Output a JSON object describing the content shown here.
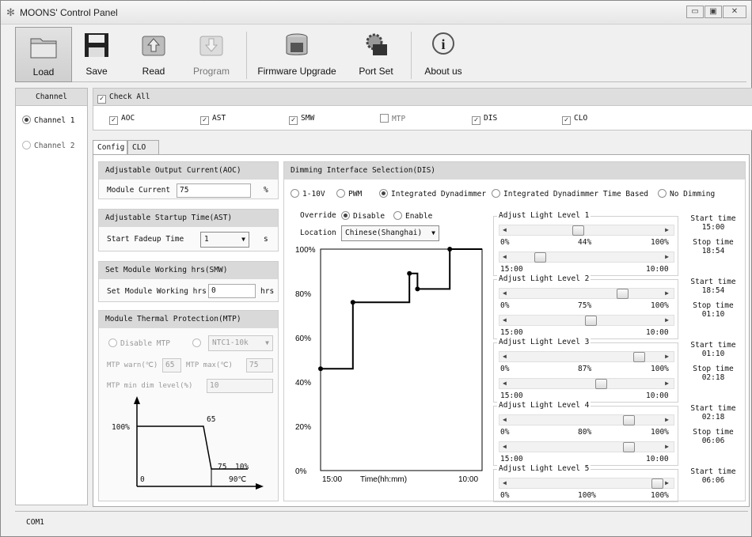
{
  "window": {
    "title": "MOONS' Control Panel"
  },
  "toolbar": {
    "load": "Load",
    "save": "Save",
    "read": "Read",
    "program": "Program",
    "firmware": "Firmware Upgrade",
    "portset": "Port Set",
    "about": "About us"
  },
  "channel": {
    "header": "Channel",
    "ch1": "Channel 1",
    "ch2": "Channel 2"
  },
  "checks": {
    "all": "Check All",
    "aoc": "AOC",
    "ast": "AST",
    "smw": "SMW",
    "mtp": "MTP",
    "dis": "DIS",
    "clo": "CLO"
  },
  "tabs": {
    "config": "Config",
    "clo": "CLO"
  },
  "aoc": {
    "title": "Adjustable Output Current(AOC)",
    "label": "Module Current",
    "value": "75",
    "unit": "%"
  },
  "ast": {
    "title": "Adjustable Startup Time(AST)",
    "label": "Start Fadeup Time",
    "value": "1",
    "unit": "s"
  },
  "smw": {
    "title": "Set Module Working hrs(SMW)",
    "label": "Set Module Working hrs",
    "value": "0",
    "unit": "hrs"
  },
  "mtp": {
    "title": "Module Thermal Protection(MTP)",
    "disable": "Disable MTP",
    "ntc": "NTC1-10k",
    "warn_label": "MTP warn(℃)",
    "warn_value": "65",
    "max_label": "MTP max(℃)",
    "max_value": "75",
    "min_label": "MTP min dim level(%)",
    "min_value": "10",
    "graph": {
      "y100": "100%",
      "p65": "65",
      "p75": "75",
      "p10": "10%",
      "x0": "0",
      "x90": "90℃"
    }
  },
  "dis": {
    "title": "Dimming Interface Selection(DIS)",
    "opt1": "1-10V",
    "opt2": "PWM",
    "opt3": "Integrated Dynadimmer",
    "opt4": "Integrated Dynadimmer Time Based",
    "opt5": "No Dimming",
    "override_label": "Override",
    "disable": "Disable",
    "enable": "Enable",
    "location_label": "Location",
    "location_value": "Chinese(Shanghai)"
  },
  "chart_data": {
    "type": "line",
    "xlabel": "Time(hh:mm)",
    "x_start": "15:00",
    "x_end": "10:00",
    "y_ticks": [
      "0%",
      "20%",
      "40%",
      "60%",
      "80%",
      "100%"
    ],
    "points": [
      [
        0,
        46
      ],
      [
        0.2,
        46
      ],
      [
        0.2,
        76
      ],
      [
        0.55,
        76
      ],
      [
        0.55,
        89
      ],
      [
        0.6,
        89
      ],
      [
        0.6,
        82
      ],
      [
        0.8,
        82
      ],
      [
        0.8,
        100
      ],
      [
        1,
        100
      ]
    ]
  },
  "levels": [
    {
      "title": "Adjust Light Level 1",
      "min": "0%",
      "val": "44%",
      "max": "100%",
      "level": 0.44,
      "t1": "15:00",
      "t2": "10:00",
      "time": 0.17,
      "start_label": "Start time",
      "start": "15:00",
      "stop_label": "Stop time",
      "stop": "18:54"
    },
    {
      "title": "Adjust Light Level 2",
      "min": "0%",
      "val": "75%",
      "max": "100%",
      "level": 0.75,
      "t1": "15:00",
      "t2": "10:00",
      "time": 0.53,
      "start_label": "Start time",
      "start": "18:54",
      "stop_label": "Stop time",
      "stop": "01:10"
    },
    {
      "title": "Adjust Light Level 3",
      "min": "0%",
      "val": "87%",
      "max": "100%",
      "level": 0.87,
      "t1": "15:00",
      "t2": "10:00",
      "time": 0.6,
      "start_label": "Start time",
      "start": "01:10",
      "stop_label": "Stop time",
      "stop": "02:18"
    },
    {
      "title": "Adjust Light Level 4",
      "min": "0%",
      "val": "80%",
      "max": "100%",
      "level": 0.8,
      "t1": "15:00",
      "t2": "10:00",
      "time": 0.8,
      "start_label": "Start time",
      "start": "02:18",
      "stop_label": "Stop time",
      "stop": "06:06"
    },
    {
      "title": "Adjust Light Level 5",
      "min": "0%",
      "val": "100%",
      "max": "100%",
      "level": 1.0,
      "start_label": "Start time",
      "start": "06:06"
    }
  ],
  "status": {
    "port": "COM1"
  }
}
